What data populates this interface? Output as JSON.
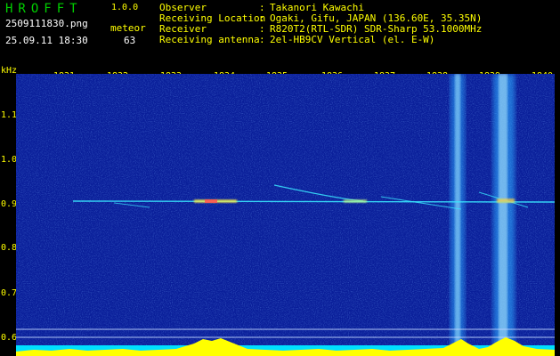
{
  "app": {
    "name": "HROFFT",
    "version": "1.0.0"
  },
  "file": {
    "name": "2509111830.png",
    "datetime": "25.09.11 18:30"
  },
  "meteor": {
    "label": "meteor",
    "count": "63"
  },
  "info": [
    {
      "key": "Observer",
      "value": "Takanori Kawachi"
    },
    {
      "key": "Receiving Location",
      "value": "Ogaki, Gifu, JAPAN (136.60E, 35.35N)"
    },
    {
      "key": "Receiver",
      "value": "R820T2(RTL-SDR) SDR-Sharp 53.1000MHz"
    },
    {
      "key": "Receiving antenna",
      "value": "2el-HB9CV Vertical (el. E-W)"
    }
  ],
  "axis": {
    "y_unit": "kHz",
    "x_ticks": [
      "1831",
      "1832",
      "1833",
      "1834",
      "1835",
      "1836",
      "1837",
      "1838",
      "1839",
      "1840"
    ],
    "y_ticks": [
      "1.1",
      "1.0",
      "0.9",
      "0.8",
      "0.7",
      "0.6"
    ]
  },
  "colors": {
    "background": "#000000",
    "spectrogram_base": "#0a1f9a",
    "header_text": "#ffff00",
    "logo": "#00d000",
    "signal_cyan": "#00ffff",
    "level_yellow": "#ffff00"
  }
}
